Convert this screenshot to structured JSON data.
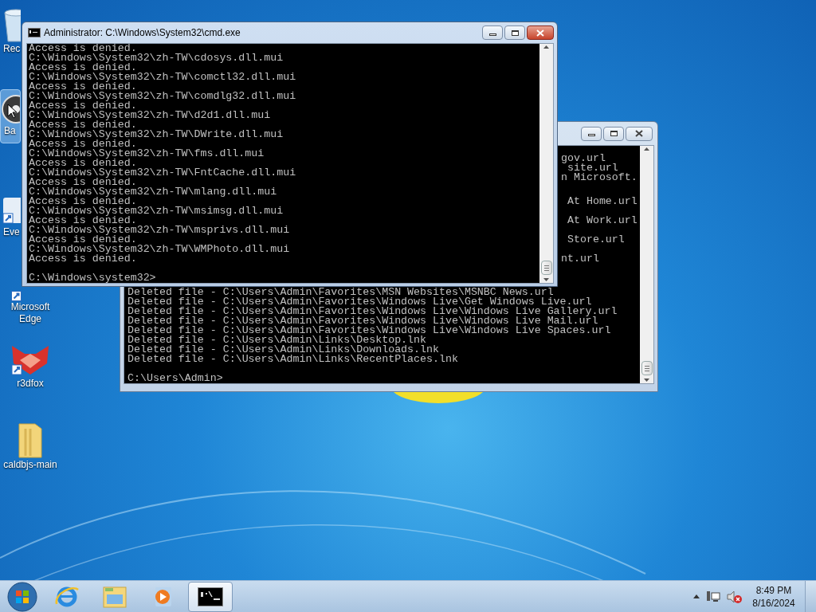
{
  "desktop_icons": [
    {
      "label": "Rec",
      "kind": "recycle",
      "selected": false
    },
    {
      "label": "Ba",
      "kind": "app",
      "selected": true
    },
    {
      "label": "Eve",
      "kind": "shortcut",
      "selected": false
    },
    {
      "label": "Microsoft Edge",
      "kind": "edge",
      "selected": false
    },
    {
      "label": "r3dfox",
      "kind": "fox",
      "selected": false
    },
    {
      "label": "caldbjs-main",
      "kind": "folder",
      "selected": false
    }
  ],
  "back_window": {
    "fragments_dense": [
      "gov.url",
      " site.url",
      "n Microsoft."
    ],
    "fragments_sparse": [
      " At Home.url",
      " At Work.url",
      " Store.url",
      "nt.url"
    ],
    "lines": [
      "Deleted file - C:\\Users\\Admin\\Favorites\\MSN Websites\\MSNBC News.url",
      "Deleted file - C:\\Users\\Admin\\Favorites\\Windows Live\\Get Windows Live.url",
      "Deleted file - C:\\Users\\Admin\\Favorites\\Windows Live\\Windows Live Gallery.url",
      "Deleted file - C:\\Users\\Admin\\Favorites\\Windows Live\\Windows Live Mail.url",
      "Deleted file - C:\\Users\\Admin\\Favorites\\Windows Live\\Windows Live Spaces.url",
      "Deleted file - C:\\Users\\Admin\\Links\\Desktop.lnk",
      "Deleted file - C:\\Users\\Admin\\Links\\Downloads.lnk",
      "Deleted file - C:\\Users\\Admin\\Links\\RecentPlaces.lnk"
    ],
    "prompt": "C:\\Users\\Admin>"
  },
  "front_window": {
    "title": "Administrator: C:\\Windows\\System32\\cmd.exe",
    "lines": [
      "Access is denied.",
      "C:\\Windows\\System32\\zh-TW\\cdosys.dll.mui",
      "Access is denied.",
      "C:\\Windows\\System32\\zh-TW\\comctl32.dll.mui",
      "Access is denied.",
      "C:\\Windows\\System32\\zh-TW\\comdlg32.dll.mui",
      "Access is denied.",
      "C:\\Windows\\System32\\zh-TW\\d2d1.dll.mui",
      "Access is denied.",
      "C:\\Windows\\System32\\zh-TW\\DWrite.dll.mui",
      "Access is denied.",
      "C:\\Windows\\System32\\zh-TW\\fms.dll.mui",
      "Access is denied.",
      "C:\\Windows\\System32\\zh-TW\\FntCache.dll.mui",
      "Access is denied.",
      "C:\\Windows\\System32\\zh-TW\\mlang.dll.mui",
      "Access is denied.",
      "C:\\Windows\\System32\\zh-TW\\msimsg.dll.mui",
      "Access is denied.",
      "C:\\Windows\\System32\\zh-TW\\msprivs.dll.mui",
      "Access is denied.",
      "C:\\Windows\\System32\\zh-TW\\WMPhoto.dll.mui",
      "Access is denied."
    ],
    "prompt": "C:\\Windows\\system32>"
  },
  "taskbar": {
    "buttons": [
      {
        "kind": "ie",
        "selected": false
      },
      {
        "kind": "explorer",
        "selected": false
      },
      {
        "kind": "media",
        "selected": false
      },
      {
        "kind": "cmd",
        "selected": true
      }
    ],
    "time": "8:49 PM",
    "date": "8/16/2024"
  }
}
